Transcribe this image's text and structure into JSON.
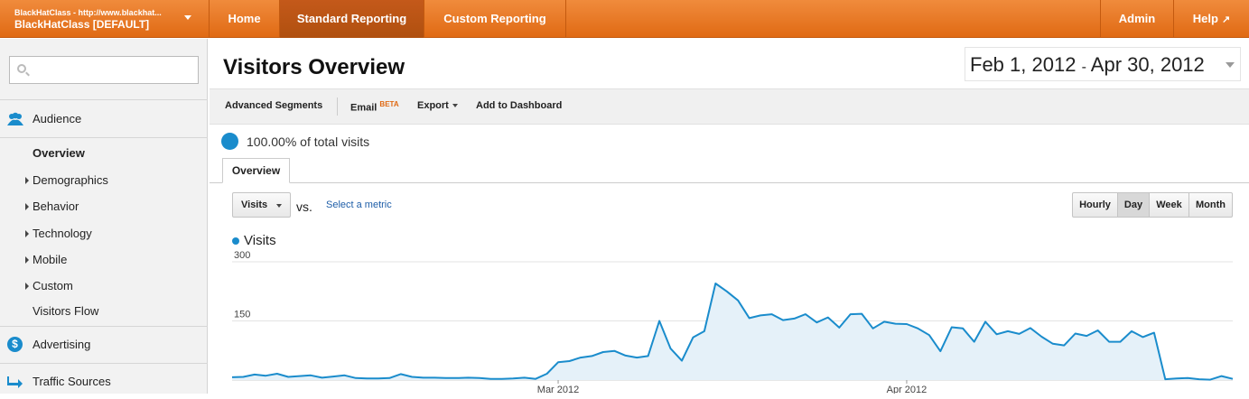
{
  "account": {
    "line1": "BlackHatClass - http://www.blackhat...",
    "line2": "BlackHatClass [DEFAULT]"
  },
  "nav": {
    "home": "Home",
    "standard": "Standard Reporting",
    "custom": "Custom Reporting",
    "admin": "Admin",
    "help": "Help"
  },
  "sidebar": {
    "search_placeholder": "",
    "audience": "Audience",
    "items": [
      {
        "label": "Overview",
        "expandable": false,
        "active": true
      },
      {
        "label": "Demographics",
        "expandable": true
      },
      {
        "label": "Behavior",
        "expandable": true
      },
      {
        "label": "Technology",
        "expandable": true
      },
      {
        "label": "Mobile",
        "expandable": true
      },
      {
        "label": "Custom",
        "expandable": true
      },
      {
        "label": "Visitors Flow",
        "expandable": false
      }
    ],
    "advertising": "Advertising",
    "traffic_sources": "Traffic Sources"
  },
  "page": {
    "title": "Visitors Overview",
    "date_start": "Feb 1, 2012",
    "date_sep": "-",
    "date_end": "Apr 30, 2012"
  },
  "toolbar": {
    "segments": "Advanced Segments",
    "email": "Email",
    "beta": "BETA",
    "export": "Export",
    "dashboard": "Add to Dashboard"
  },
  "summary": {
    "total_visits": "100.00% of total visits"
  },
  "tabs": {
    "overview": "Overview"
  },
  "graph_controls": {
    "metric": "Visits",
    "vs": "vs.",
    "select_metric": "Select a metric",
    "granularity": [
      "Hourly",
      "Day",
      "Week",
      "Month"
    ],
    "selected_granularity": "Day"
  },
  "colors": {
    "accent": "#e06a14",
    "series": "#1a8ccc"
  },
  "chart_data": {
    "type": "area",
    "x_start": "2012-02-01",
    "x_end": "2012-04-30",
    "series": [
      {
        "name": "Visits",
        "values": [
          7,
          8,
          14,
          11,
          16,
          8,
          10,
          12,
          6,
          9,
          12,
          5,
          4,
          4,
          5,
          15,
          8,
          6,
          6,
          5,
          5,
          6,
          5,
          3,
          3,
          4,
          6,
          3,
          16,
          45,
          48,
          57,
          61,
          71,
          74,
          62,
          57,
          61,
          150,
          80,
          49,
          108,
          124,
          245,
          225,
          202,
          157,
          164,
          167,
          152,
          156,
          167,
          146,
          159,
          133,
          167,
          168,
          131,
          148,
          143,
          142,
          131,
          114,
          73,
          134,
          131,
          97,
          148,
          116,
          124,
          117,
          132,
          110,
          92,
          88,
          118,
          112,
          126,
          97,
          97,
          124,
          109,
          120,
          2,
          4,
          5,
          2,
          1,
          10,
          3
        ]
      }
    ],
    "xticks": [
      {
        "label": "Mar 2012",
        "index": 29
      },
      {
        "label": "Apr 2012",
        "index": 60
      }
    ],
    "yticks": [
      150,
      300
    ],
    "ylim": [
      0,
      300
    ],
    "grid": true,
    "legend": "top-left"
  }
}
